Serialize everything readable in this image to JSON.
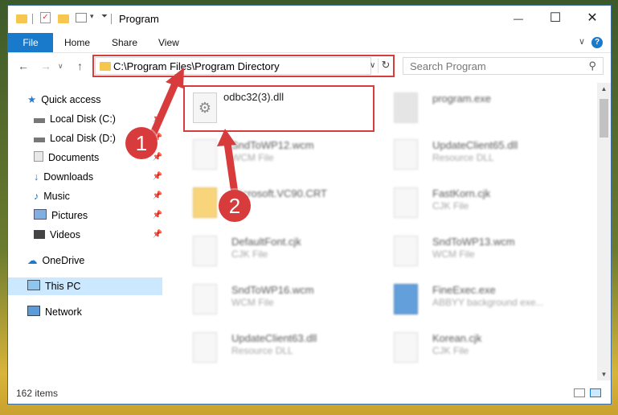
{
  "window": {
    "title": "Program",
    "controls": {
      "minimize": "—",
      "maximize": "☐",
      "close": "✕"
    }
  },
  "ribbon": {
    "file": "File",
    "tabs": [
      "Home",
      "Share",
      "View"
    ],
    "help": "?"
  },
  "nav": {
    "back": "←",
    "forward": "→",
    "up": "↑",
    "address": "C:\\Program Files\\Program Directory",
    "search_placeholder": "Search Program"
  },
  "sidebar": {
    "items": [
      {
        "label": "Quick access",
        "icon": "star-icon"
      },
      {
        "label": "Local Disk (C:)",
        "icon": "drive-icon"
      },
      {
        "label": "Local Disk (D:)",
        "icon": "drive-icon"
      },
      {
        "label": "Documents",
        "icon": "documents-icon"
      },
      {
        "label": "Downloads",
        "icon": "download-icon"
      },
      {
        "label": "Music",
        "icon": "music-icon"
      },
      {
        "label": "Pictures",
        "icon": "pictures-icon"
      },
      {
        "label": "Videos",
        "icon": "videos-icon"
      },
      {
        "label": "OneDrive",
        "icon": "cloud-icon"
      },
      {
        "label": "This PC",
        "icon": "computer-icon"
      },
      {
        "label": "Network",
        "icon": "network-icon"
      }
    ]
  },
  "files": [
    {
      "name": "odbc32(3).dll",
      "type": ""
    },
    {
      "name": "program.exe",
      "type": ""
    },
    {
      "name": "SndToWP12.wcm",
      "type": "WCM File"
    },
    {
      "name": "UpdateClient65.dll",
      "type": "Resource DLL"
    },
    {
      "name": "Microsoft.VC90.CRT",
      "type": ""
    },
    {
      "name": "FastKorn.cjk",
      "type": "CJK File"
    },
    {
      "name": "DefaultFont.cjk",
      "type": "CJK File"
    },
    {
      "name": "SndToWP13.wcm",
      "type": "WCM File"
    },
    {
      "name": "SndToWP16.wcm",
      "type": "WCM File"
    },
    {
      "name": "FineExec.exe",
      "type": "ABBYY background exe..."
    },
    {
      "name": "UpdateClient63.dll",
      "type": "Resource DLL"
    },
    {
      "name": "Korean.cjk",
      "type": "CJK File"
    }
  ],
  "status": {
    "count": "162 items"
  },
  "annotations": {
    "step1": "1",
    "step2": "2"
  },
  "colors": {
    "accent": "#1979ca",
    "highlight": "#d63d3d",
    "selection": "#cce8ff"
  }
}
